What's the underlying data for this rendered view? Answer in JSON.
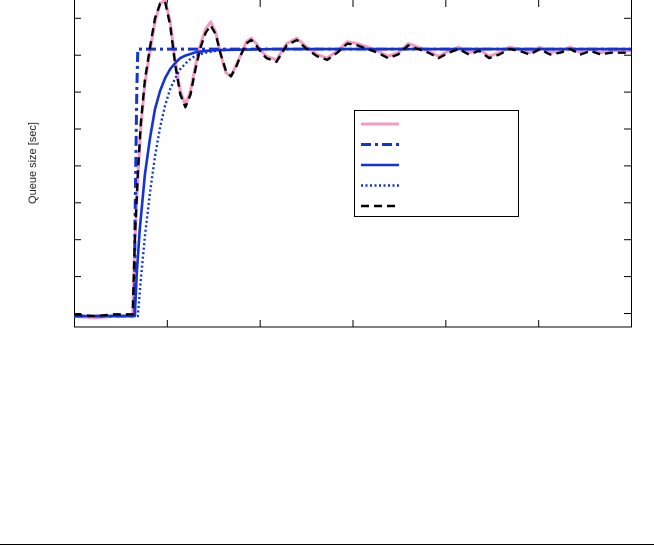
{
  "chart_data": {
    "type": "line",
    "title": "",
    "xlabel": "",
    "ylabel": "Queue size [sec]",
    "xlim": [
      0,
      55
    ],
    "ylim": [
      -0.05,
      0.85
    ],
    "x_tick_count": 6,
    "y_tick_count": 9,
    "grid": false,
    "legend": {
      "placement": "center-right",
      "entries": [
        "",
        "",
        "",
        "",
        ""
      ]
    },
    "series": [
      {
        "style": "solid",
        "color": "#f29bc5",
        "x": [
          0,
          2,
          4,
          5.8,
          6.0,
          6.3,
          6.6,
          7.0,
          7.5,
          8.0,
          8.5,
          9.0,
          9.5,
          10.0,
          10.5,
          11.0,
          11.5,
          12.0,
          12.5,
          13.0,
          13.5,
          14.0,
          14.5,
          15.0,
          15.5,
          16.0,
          16.5,
          17.0,
          17.5,
          18.0,
          18.5,
          19.0,
          20.0,
          21.0,
          22.0,
          23.0,
          24.0,
          25.0,
          26.0,
          27.0,
          28.0,
          29.0,
          30.0,
          31.0,
          32.0,
          33.0,
          34.0,
          35.0,
          36.0,
          37.0,
          38.0,
          39.0,
          40.0,
          41.0,
          42.0,
          43.0,
          44.0,
          45.0,
          46.0,
          47.0,
          48.0,
          49.0,
          50.0,
          51.0,
          52.0,
          53.0,
          54.0,
          55.0
        ],
        "y": [
          -0.02,
          -0.025,
          -0.02,
          -0.02,
          0.18,
          0.36,
          0.5,
          0.62,
          0.71,
          0.79,
          0.84,
          0.85,
          0.79,
          0.68,
          0.6,
          0.56,
          0.6,
          0.67,
          0.73,
          0.77,
          0.79,
          0.76,
          0.7,
          0.65,
          0.64,
          0.67,
          0.7,
          0.735,
          0.745,
          0.73,
          0.71,
          0.695,
          0.685,
          0.73,
          0.745,
          0.72,
          0.7,
          0.69,
          0.71,
          0.735,
          0.73,
          0.72,
          0.71,
          0.695,
          0.705,
          0.73,
          0.72,
          0.71,
          0.695,
          0.71,
          0.72,
          0.705,
          0.715,
          0.695,
          0.705,
          0.72,
          0.715,
          0.705,
          0.72,
          0.705,
          0.71,
          0.72,
          0.705,
          0.715,
          0.705,
          0.71,
          0.71,
          0.71
        ]
      },
      {
        "style": "dashdot",
        "color": "#1233d6",
        "x": [
          0,
          6.0,
          6.0,
          6.2,
          6.3,
          55
        ],
        "y": [
          -0.02,
          -0.02,
          0.2,
          0.6,
          0.715,
          0.715
        ]
      },
      {
        "style": "solid-thick",
        "color": "#1233d6",
        "x": [
          0,
          6.0,
          6.2,
          6.5,
          7.0,
          7.5,
          8.0,
          8.5,
          9.0,
          9.5,
          10.0,
          10.5,
          11.0,
          12.0,
          13.0,
          14.0,
          15.0,
          20.0,
          30.0,
          40.0,
          55.0
        ],
        "y": [
          -0.02,
          -0.02,
          0.1,
          0.22,
          0.37,
          0.47,
          0.55,
          0.6,
          0.635,
          0.66,
          0.677,
          0.69,
          0.697,
          0.706,
          0.71,
          0.712,
          0.713,
          0.715,
          0.715,
          0.715,
          0.715
        ]
      },
      {
        "style": "dotted",
        "color": "#1233d6",
        "x": [
          0,
          6.3,
          6.6,
          7.0,
          7.5,
          8.0,
          8.5,
          9.0,
          9.5,
          10.0,
          10.5,
          11.0,
          11.5,
          12.0,
          13.0,
          14.0,
          15.0,
          16.0,
          20.0,
          30.0,
          55.0
        ],
        "y": [
          -0.02,
          -0.02,
          0.08,
          0.2,
          0.32,
          0.42,
          0.5,
          0.56,
          0.605,
          0.635,
          0.66,
          0.675,
          0.688,
          0.697,
          0.705,
          0.71,
          0.712,
          0.713,
          0.715,
          0.715,
          0.715
        ]
      },
      {
        "style": "dashed",
        "color": "#000000",
        "x": [
          0,
          2,
          4,
          5.8,
          6.0,
          6.3,
          6.6,
          7.0,
          7.5,
          8.0,
          8.5,
          9.0,
          9.5,
          10.0,
          10.5,
          11.0,
          11.5,
          12.0,
          12.5,
          13.0,
          13.5,
          14.0,
          14.5,
          15.0,
          15.5,
          16.0,
          16.5,
          17.0,
          17.5,
          18.0,
          18.5,
          19.0,
          20.0,
          21.0,
          22.0,
          23.0,
          24.0,
          25.0,
          26.0,
          27.0,
          28.0,
          29.0,
          30.0,
          31.0,
          32.0,
          33.0,
          34.0,
          35.0,
          36.0,
          37.0,
          38.0,
          39.0,
          40.0,
          41.0,
          42.0,
          43.0,
          44.0,
          45.0,
          46.0,
          47.0,
          48.0,
          49.0,
          50.0,
          51.0,
          52.0,
          53.0,
          54.0,
          55.0
        ],
        "y": [
          -0.015,
          -0.02,
          -0.015,
          -0.015,
          0.19,
          0.37,
          0.51,
          0.63,
          0.72,
          0.8,
          0.84,
          0.845,
          0.78,
          0.67,
          0.59,
          0.555,
          0.59,
          0.66,
          0.72,
          0.76,
          0.78,
          0.755,
          0.7,
          0.655,
          0.64,
          0.665,
          0.7,
          0.73,
          0.74,
          0.725,
          0.705,
          0.69,
          0.68,
          0.725,
          0.74,
          0.715,
          0.695,
          0.685,
          0.705,
          0.73,
          0.725,
          0.715,
          0.705,
          0.69,
          0.7,
          0.725,
          0.715,
          0.705,
          0.69,
          0.705,
          0.715,
          0.7,
          0.71,
          0.69,
          0.7,
          0.715,
          0.71,
          0.7,
          0.715,
          0.7,
          0.705,
          0.715,
          0.7,
          0.71,
          0.7,
          0.705,
          0.705,
          0.705
        ]
      }
    ]
  }
}
